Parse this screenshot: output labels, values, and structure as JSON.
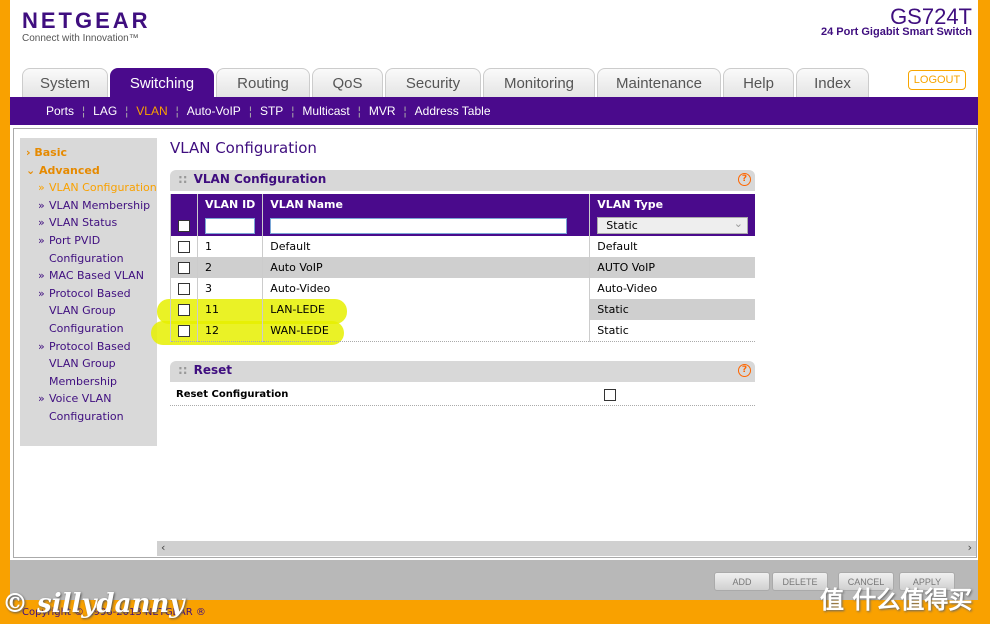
{
  "header": {
    "logo": "NETGEAR",
    "tagline": "Connect with Innovation™",
    "model": "GS724T",
    "model_desc": "24 Port Gigabit Smart Switch",
    "logout": "LOGOUT"
  },
  "tabs": [
    {
      "label": "System",
      "w": 86
    },
    {
      "label": "Switching",
      "w": 104,
      "active": true
    },
    {
      "label": "Routing",
      "w": 94
    },
    {
      "label": "QoS",
      "w": 71
    },
    {
      "label": "Security",
      "w": 96
    },
    {
      "label": "Monitoring",
      "w": 112
    },
    {
      "label": "Maintenance",
      "w": 124
    },
    {
      "label": "Help",
      "w": 71
    },
    {
      "label": "Index",
      "w": 73
    }
  ],
  "subnav": [
    {
      "label": "Ports"
    },
    {
      "label": "LAG"
    },
    {
      "label": "VLAN",
      "active": true
    },
    {
      "label": "Auto-VoIP"
    },
    {
      "label": "STP"
    },
    {
      "label": "Multicast"
    },
    {
      "label": "MVR"
    },
    {
      "label": "Address Table"
    }
  ],
  "sidebar": {
    "basic": "Basic",
    "advanced": "Advanced",
    "items": [
      "VLAN Configuration",
      "VLAN Membership",
      "VLAN Status",
      "Port PVID Configuration",
      "MAC Based VLAN",
      "Protocol Based VLAN Group Configuration",
      "Protocol Based VLAN Group Membership",
      "Voice VLAN Configuration"
    ]
  },
  "page_title": "VLAN Configuration",
  "vlan_box": {
    "title": "VLAN Configuration",
    "columns": [
      "VLAN ID",
      "VLAN Name",
      "VLAN Type"
    ],
    "new_type": "Static",
    "rows": [
      {
        "id": "1",
        "name": "Default",
        "type": "Default"
      },
      {
        "id": "2",
        "name": "Auto VoIP",
        "type": "AUTO VoIP"
      },
      {
        "id": "3",
        "name": "Auto-Video",
        "type": "Auto-Video"
      },
      {
        "id": "11",
        "name": "LAN-LEDE",
        "type": "Static"
      },
      {
        "id": "12",
        "name": "WAN-LEDE",
        "type": "Static"
      }
    ]
  },
  "reset_box": {
    "title": "Reset",
    "label": "Reset Configuration"
  },
  "buttons": [
    "ADD",
    "DELETE",
    "CANCEL",
    "APPLY"
  ],
  "footer": {
    "copyright": "Copyright © 1996-2013 NETGEAR ®"
  },
  "watermarks": [
    "© sillydanny",
    "值 什么值得买"
  ],
  "colors": {
    "brand": "#4a0a8c",
    "accent": "#f9a100",
    "highlight": "#e6f000"
  }
}
